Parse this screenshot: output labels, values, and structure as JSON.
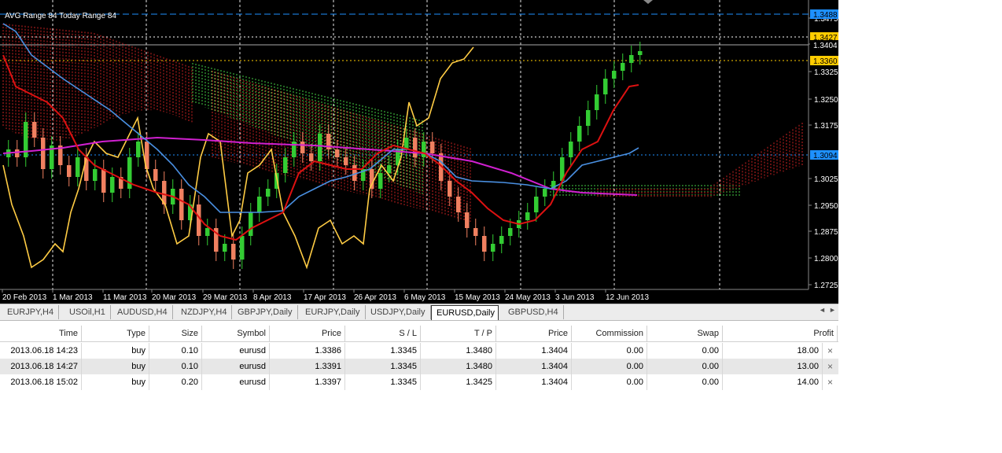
{
  "chart": {
    "header_text": "AVG Range 84   Today Range 84",
    "price_axis": [
      "1.3475",
      "1.3404",
      "1.3325",
      "1.3250",
      "1.3175",
      "1.3025",
      "1.2950",
      "1.2875",
      "1.2800",
      "1.2725"
    ],
    "price_labels": [
      {
        "text": "1.3488",
        "color": "#1e90ff",
        "text_color": "#000000"
      },
      {
        "text": "1.3427",
        "color": "#ffcc00",
        "text_color": "#000000"
      },
      {
        "text": "1.3404",
        "color": "#000000",
        "text_color": "#ffffff"
      },
      {
        "text": "1.3360",
        "color": "#ffcc00",
        "text_color": "#000000"
      },
      {
        "text": "1.3094",
        "color": "#1e90ff",
        "text_color": "#000000"
      }
    ],
    "date_axis": [
      "20 Feb 2013",
      "1 Mar 2013",
      "11 Mar 2013",
      "20 Mar 2013",
      "29 Mar 2013",
      "8 Apr 2013",
      "17 Apr 2013",
      "26 Apr 2013",
      "6 May 2013",
      "15 May 2013",
      "24 May 2013",
      "3 Jun 2013",
      "12 Jun 2013"
    ],
    "colors": {
      "background": "#000000",
      "bull_candle": "#33cc33",
      "bear_candle": "#f08060",
      "tenkan": "#dd1111",
      "kijun": "#4a90e2",
      "chikou": "#ffcc44",
      "magenta": "#d020d0",
      "cloud_bull": "#44cc44",
      "cloud_bear": "#cc2222",
      "grid": "#ffffff"
    }
  },
  "tabs": [
    "EURJPY,H4",
    "USOil,H1",
    "AUDUSD,H4",
    "NZDJPY,H4",
    "GBPJPY,Daily",
    "EURJPY,Daily",
    "USDJPY,Daily",
    "EURUSD,Daily",
    "GBPUSD,H4"
  ],
  "active_tab": "EURUSD,Daily",
  "trades": {
    "columns": [
      "Time",
      "Type",
      "Size",
      "Symbol",
      "Price",
      "S / L",
      "T / P",
      "Price",
      "Commission",
      "Swap",
      "Profit"
    ],
    "rows": [
      [
        "2013.06.18 14:23",
        "buy",
        "0.10",
        "eurusd",
        "1.3386",
        "1.3345",
        "1.3480",
        "1.3404",
        "0.00",
        "0.00",
        "18.00"
      ],
      [
        "2013.06.18 14:27",
        "buy",
        "0.10",
        "eurusd",
        "1.3391",
        "1.3345",
        "1.3480",
        "1.3404",
        "0.00",
        "0.00",
        "13.00"
      ],
      [
        "2013.06.18 15:02",
        "buy",
        "0.20",
        "eurusd",
        "1.3397",
        "1.3345",
        "1.3425",
        "1.3404",
        "0.00",
        "0.00",
        "14.00"
      ]
    ]
  }
}
